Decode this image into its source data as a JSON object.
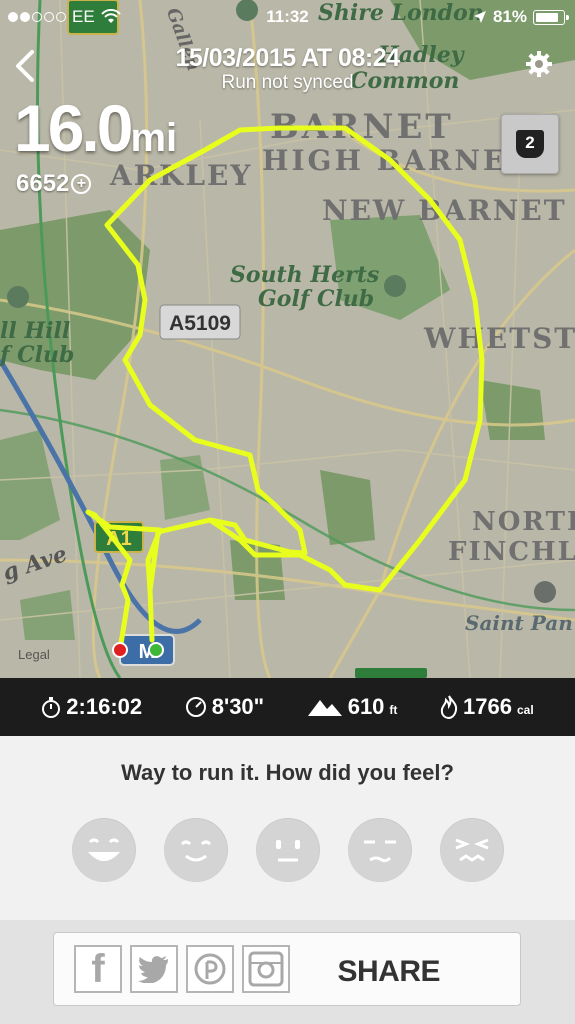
{
  "status_bar": {
    "carrier": "EE",
    "time": "11:32",
    "battery": "81%"
  },
  "header": {
    "title": "15/03/2015 AT 08:24",
    "subtitle": "Run not synced"
  },
  "summary": {
    "distance_value": "16.0",
    "distance_unit": "mi",
    "fuel_points": "6652",
    "lap_badge": "2"
  },
  "map": {
    "road_label": "A5109",
    "road_label_2": "A1",
    "legal": "Legal",
    "labels": {
      "shire_london": "Shire London",
      "hadley": "Hadley",
      "common": "Common",
      "barnet": "BARNET",
      "high_barnet": "HIGH BARNET",
      "arkley": "ARKLEY",
      "new_barnet": "NEW BARNET",
      "south_herts": "South Herts",
      "golf_club": "Golf Club",
      "whetstone": "WHETSTO",
      "mill_hill": "ll Hill",
      "mill_hill_club": "f Club",
      "north": "NORTH",
      "finchley": "FINCHLE",
      "saint_pan": "Saint Pan",
      "g_ave": "g Ave",
      "gallen": "Gallen"
    },
    "route_color": "#e8ff1e"
  },
  "stats": {
    "duration": "2:16:02",
    "pace": "8'30\"",
    "elevation": "610",
    "elevation_unit": "ft",
    "calories": "1766",
    "calories_unit": "cal"
  },
  "feel": {
    "question": "Way to run it. How did you feel?",
    "faces": [
      "very-happy",
      "happy",
      "neutral",
      "meh",
      "bad"
    ]
  },
  "share": {
    "label": "SHARE",
    "icons": [
      "facebook-icon",
      "twitter-icon",
      "pinterest-icon",
      "instagram-icon"
    ]
  }
}
